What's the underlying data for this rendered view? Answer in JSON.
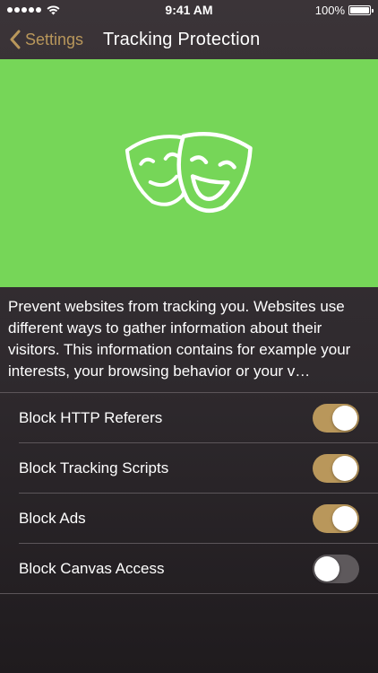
{
  "status_bar": {
    "time": "9:41 AM",
    "battery": "100%",
    "signal_dots": 5
  },
  "nav": {
    "back_label": "Settings",
    "title": "Tracking Protection"
  },
  "hero": {
    "background_color": "#76d658",
    "icon": "theater-masks-icon"
  },
  "description": "Prevent websites from tracking you. Websites use different ways to gather information about their visitors. This information contains for example your interests, your browsing behavior or your v…",
  "toggles": [
    {
      "label": "Block HTTP Referers",
      "on": true
    },
    {
      "label": "Block Tracking Scripts",
      "on": true
    },
    {
      "label": "Block Ads",
      "on": true
    },
    {
      "label": "Block Canvas Access",
      "on": false
    }
  ],
  "colors": {
    "accent": "#b9975b",
    "switch_off": "#5e595c"
  }
}
